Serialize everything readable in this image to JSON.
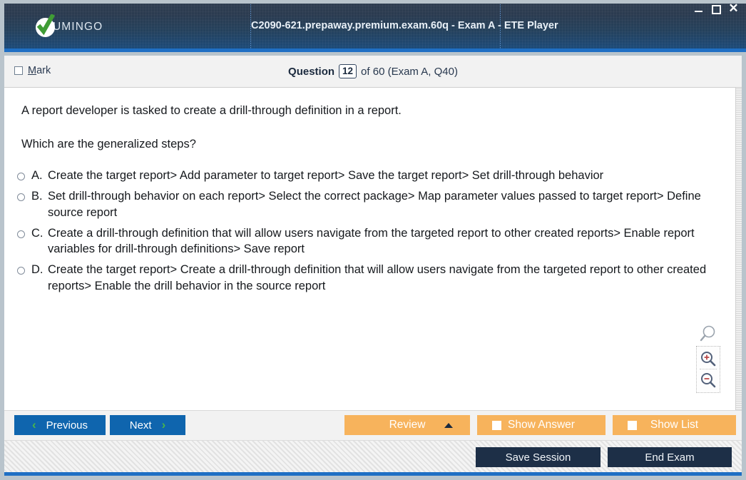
{
  "window": {
    "title": "C2090-621.prepaway.premium.exam.60q - Exam A - ETE Player",
    "brand": "UMINGO",
    "minimize_label": "Minimize",
    "maximize_label": "Maximize",
    "close_label": "✕",
    "accent_blue": "#1f6fc4",
    "brand_green": "#49b649"
  },
  "header": {
    "mark_label_prefix": "M",
    "mark_label_rest": "ark",
    "question_word": "Question",
    "question_number": "12",
    "question_of": "of 60 (Exam A, Q40)"
  },
  "question": {
    "stem": "A report developer is tasked to create a drill-through definition in a report.",
    "prompt": "Which are the generalized steps?",
    "options": [
      {
        "letter": "A.",
        "text": "Create the target report> Add parameter to target report> Save the target report> Set drill-through behavior"
      },
      {
        "letter": "B.",
        "text": "Set drill-through behavior on each report> Select the correct package> Map parameter values passed to target report> Define source report"
      },
      {
        "letter": "C.",
        "text": "Create a drill-through definition that will allow users navigate from the targeted report to other created reports> Enable report variables for drill-through definitions> Save report"
      },
      {
        "letter": "D.",
        "text": "Create the target report> Create a drill-through definition that will allow users navigate from the targeted report to other created reports> Enable the drill behavior in the source report"
      }
    ]
  },
  "zoom_tools": {
    "reset_label": "magnifier-icon",
    "zoom_in_label": "zoom-in-icon",
    "zoom_out_label": "zoom-out-icon"
  },
  "toolbar": {
    "previous_label": "Previous",
    "next_label": "Next",
    "review_label": "Review",
    "show_answer_label": "Show Answer",
    "show_list_label": "Show List",
    "prev_chevron": "‹",
    "next_chevron": "›"
  },
  "statusbar": {
    "save_session_label": "Save Session",
    "end_exam_label": "End Exam"
  }
}
